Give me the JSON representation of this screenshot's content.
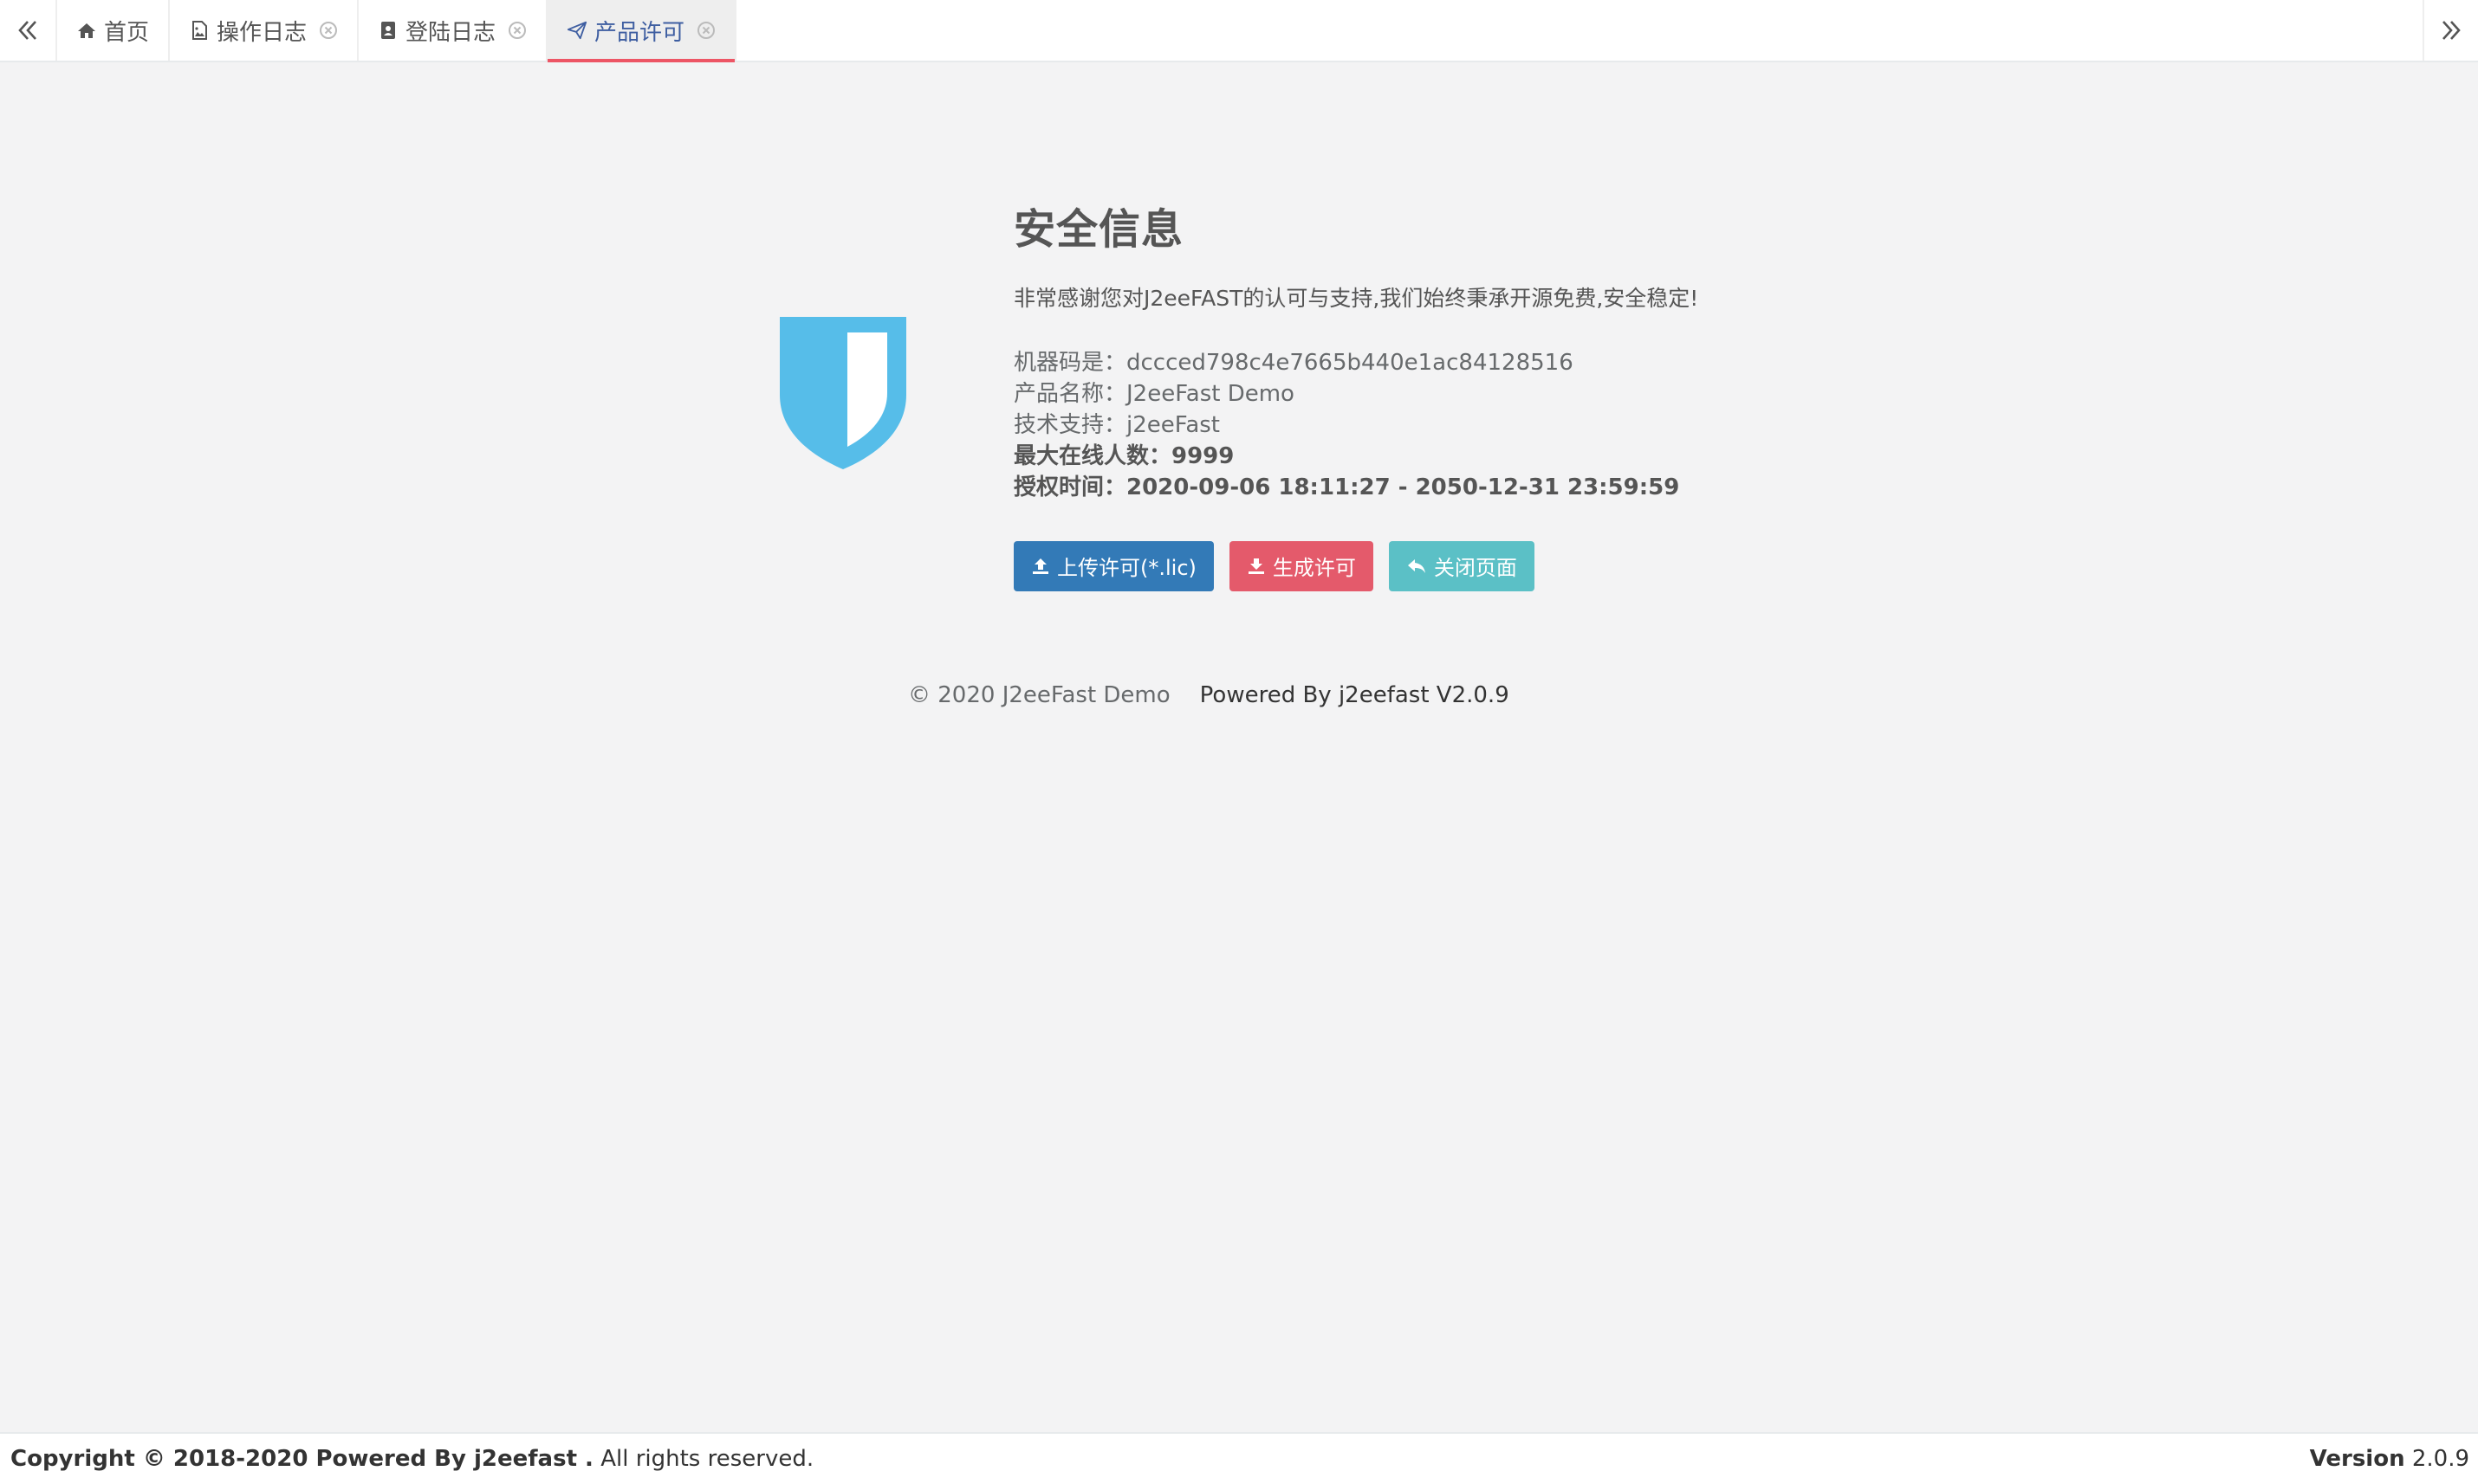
{
  "tabs": [
    {
      "label": "首页",
      "icon": "home-icon",
      "closable": false,
      "active": false
    },
    {
      "label": "操作日志",
      "icon": "image-file-icon",
      "closable": true,
      "active": false
    },
    {
      "label": "登陆日志",
      "icon": "address-book-icon",
      "closable": true,
      "active": false
    },
    {
      "label": "产品许可",
      "icon": "paper-plane-icon",
      "closable": true,
      "active": true
    }
  ],
  "info": {
    "title": "安全信息",
    "thanks": "非常感谢您对J2eeFAST的认可与支持,我们始终秉承开源免费,安全稳定!",
    "machine_code": "机器码是：dccced798c4e7665b440e1ac84128516",
    "product_name": "产品名称：J2eeFast Demo",
    "tech_support": "技术支持：j2eeFast",
    "max_online": "最大在线人数：9999",
    "auth_time": "授权时间：2020-09-06 18:11:27 - 2050-12-31 23:59:59"
  },
  "buttons": {
    "upload": "上传许可(*.lic)",
    "generate": "生成许可",
    "close": "关闭页面"
  },
  "credits": {
    "copyright": "© 2020 J2eeFast Demo",
    "powered": "Powered By j2eefast V2.0.9"
  },
  "footer": {
    "copyright_bold": "Copyright © 2018-2020 Powered By j2eefast .",
    "rights": " All rights reserved.",
    "version_label": "Version",
    "version_value": " 2.0.9"
  },
  "colors": {
    "shield": "#56bde9",
    "active_tab_underline": "#ed5565",
    "active_tab_text": "#3e5ea1",
    "btn_primary": "#337ab7",
    "btn_danger": "#e45a6b",
    "btn_info": "#5bc0c6"
  }
}
